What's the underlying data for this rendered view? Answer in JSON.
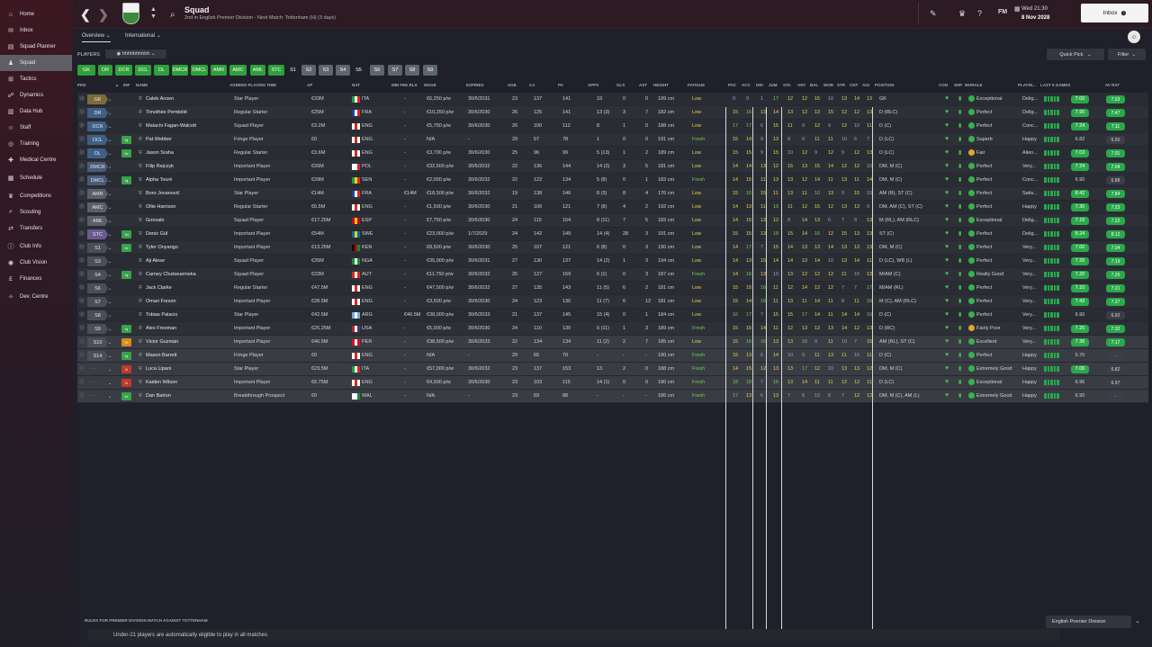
{
  "sidebar": {
    "items": [
      {
        "label": "Home",
        "icon": "home-icon",
        "glyph": "⌂"
      },
      {
        "label": "Inbox",
        "icon": "inbox-icon",
        "glyph": "✉"
      },
      {
        "label": "Squad Planner",
        "icon": "squad-planner-icon",
        "glyph": "▤"
      },
      {
        "label": "Squad",
        "icon": "squad-icon",
        "glyph": "♟",
        "active": true
      },
      {
        "label": "Tactics",
        "icon": "tactics-icon",
        "glyph": "⊞"
      },
      {
        "label": "Dynamics",
        "icon": "dynamics-icon",
        "glyph": "☍"
      },
      {
        "label": "Data Hub",
        "icon": "data-hub-icon",
        "glyph": "▥"
      },
      {
        "label": "Staff",
        "icon": "staff-icon",
        "glyph": "☺"
      },
      {
        "label": "Training",
        "icon": "training-icon",
        "glyph": "◎"
      },
      {
        "label": "Medical Centre",
        "icon": "medical-icon",
        "glyph": "✚"
      },
      {
        "label": "Schedule",
        "icon": "schedule-icon",
        "glyph": "▦"
      },
      {
        "label": "Competitions",
        "icon": "trophy-icon",
        "glyph": "♛"
      },
      {
        "label": "Scouting",
        "icon": "scouting-icon",
        "glyph": "⌕"
      },
      {
        "label": "Transfers",
        "icon": "transfers-icon",
        "glyph": "⇄"
      },
      {
        "label": "Club Info",
        "icon": "club-info-icon",
        "glyph": "ⓘ"
      },
      {
        "label": "Club Vision",
        "icon": "club-vision-icon",
        "glyph": "◉"
      },
      {
        "label": "Finances",
        "icon": "finances-icon",
        "glyph": "£"
      },
      {
        "label": "Dev. Centre",
        "icon": "dev-centre-icon",
        "glyph": "✧"
      }
    ]
  },
  "header": {
    "title": "Squad",
    "subtitle": "2nd in English Premier Division - Next Match: Tottenham (H) (3 days)",
    "date_line1": "Wed 21:30",
    "date_line2": "8 Nov 2028",
    "inbox_label": "Inbox",
    "fm_label": "FM",
    "back": "❮",
    "forward": "❯"
  },
  "subnav": {
    "overview": "Overview",
    "international": "International",
    "players_label": "PLAYERS",
    "view_name": "hhhhhhhhhh",
    "quick_pick": "Quick Pick",
    "filter": "Filter"
  },
  "chips": [
    "GK",
    "DR",
    "DCR",
    "DCL",
    "DL",
    "DMCR",
    "DMCL",
    "AMR",
    "AMC",
    "AML",
    "STC",
    "S1",
    "S2",
    "S3",
    "S4",
    "S5",
    "S6",
    "S7",
    "S8",
    "S9"
  ],
  "columns": {
    "pkd": "PKD",
    "inf": "INF",
    "name": "NAME",
    "apt": "AGREED PLAYING TIME",
    "ap": "AP",
    "nat": "NAT",
    "mfr": "MIN FEE RLS",
    "wage": "WAGE",
    "expires": "EXPIRES",
    "age": "AGE",
    "ca": "CA",
    "pa": "PA",
    "apps": "APPS",
    "gls": "GLS",
    "ast": "AST",
    "height": "HEIGHT",
    "fatigue": "FATIGUE",
    "pac": "PAC",
    "acc": "ACC",
    "dri": "DRI",
    "jum": "JUM",
    "sta": "STA",
    "ant": "ANT",
    "bal": "BAL",
    "wor": "WOR",
    "str": "STR",
    "cnt": "CNT",
    "agi": "AGI",
    "position": "POSITION",
    "con": "CON",
    "shp": "SHP",
    "morale": "MORALE",
    "playing": "PLAYIN...",
    "last5": "LAST 5 GAMES",
    "avrat": "AV RAT"
  },
  "players": [
    {
      "pos": "GK",
      "inf": "",
      "name": "Caleb Ansen",
      "apt": "Star Player",
      "ap": "€33M",
      "nat": "ITA",
      "mfr": "-",
      "wage": "€6,250 p/w",
      "expires": "30/6/2031",
      "age": "23",
      "ca": "137",
      "pa": "141",
      "apps": "19",
      "gls": "0",
      "ast": "0",
      "height": "199 cm",
      "fatigue": "Low",
      "attrs": [
        "9",
        "9",
        "1",
        "17",
        "12",
        "12",
        "15",
        "10",
        "13",
        "14",
        "13"
      ],
      "position": "GK",
      "morale": "Exceptional",
      "playing": "Delig...",
      "last5": "7.00",
      "avrat": "7.03"
    },
    {
      "pos": "DR",
      "inf": "",
      "name": "Timothée Pembélé",
      "apt": "Regular Starter",
      "ap": "€25M",
      "nat": "FRA",
      "mfr": "-",
      "wage": "€10,250 p/w",
      "expires": "30/6/2030",
      "age": "26",
      "ca": "125",
      "pa": "141",
      "apps": "13 (3)",
      "gls": "3",
      "ast": "7",
      "height": "182 cm",
      "fatigue": "Low",
      "attrs": [
        "15",
        "16",
        "13",
        "14",
        "13",
        "12",
        "13",
        "15",
        "12",
        "12",
        "13"
      ],
      "position": "D (RLC)",
      "morale": "Perfect",
      "playing": "Delig...",
      "last5": "7.90",
      "avrat": "7.47"
    },
    {
      "pos": "DCR",
      "inf": "",
      "name": "Malachi Fagan-Walcott",
      "apt": "Squad Player",
      "ap": "€3.2M",
      "nat": "ENG",
      "mfr": "-",
      "wage": "€5,750 p/w",
      "expires": "30/6/2030",
      "age": "26",
      "ca": "100",
      "pa": "112",
      "apps": "8",
      "gls": "1",
      "ast": "0",
      "height": "188 cm",
      "fatigue": "Low",
      "attrs": [
        "17",
        "17",
        "6",
        "15",
        "11",
        "9",
        "12",
        "9",
        "12",
        "10",
        "11"
      ],
      "position": "D (C)",
      "morale": "Perfect",
      "playing": "Conc...",
      "last5": "7.24",
      "avrat": "7.11"
    },
    {
      "pos": "DCL",
      "inf": "Inj",
      "name": "Pat Webber",
      "apt": "Fringe Player",
      "ap": "€0",
      "nat": "ENG",
      "mfr": "-",
      "wage": "N/A",
      "expires": "-",
      "age": "29",
      "ca": "57",
      "pa": "78",
      "apps": "1",
      "gls": "0",
      "ast": "0",
      "height": "191 cm",
      "fatigue": "Fresh",
      "attrs": [
        "15",
        "14",
        "9",
        "13",
        "8",
        "9",
        "11",
        "11",
        "10",
        "6",
        "7"
      ],
      "position": "D (LC)",
      "morale": "Superb",
      "playing": "Happy",
      "last5": "6.82",
      "avrat": "6.50"
    },
    {
      "pos": "DL",
      "inf": "Int",
      "name": "Jason Sraha",
      "apt": "Regular Starter",
      "ap": "€3.6M",
      "nat": "ENG",
      "mfr": "-",
      "wage": "€3,700 p/w",
      "expires": "30/6/2030",
      "age": "25",
      "ca": "96",
      "pa": "99",
      "apps": "5 (13)",
      "gls": "1",
      "ast": "2",
      "height": "189 cm",
      "fatigue": "Low",
      "attrs": [
        "15",
        "15",
        "9",
        "15",
        "10",
        "12",
        "9",
        "12",
        "9",
        "12",
        "13"
      ],
      "position": "D (LC)",
      "morale": "Fair",
      "playing": "Alien...",
      "last5": "7.03",
      "avrat": "7.01"
    },
    {
      "pos": "DMCR",
      "inf": "",
      "name": "Filip Rejczyk",
      "apt": "Important Player",
      "ap": "€26M",
      "nat": "POL",
      "mfr": "-",
      "wage": "€32,500 p/w",
      "expires": "30/6/2032",
      "age": "22",
      "ca": "136",
      "pa": "144",
      "apps": "14 (2)",
      "gls": "3",
      "ast": "5",
      "height": "181 cm",
      "fatigue": "Low",
      "attrs": [
        "14",
        "14",
        "13",
        "12",
        "15",
        "13",
        "15",
        "14",
        "12",
        "12",
        "16"
      ],
      "position": "DM, M (C)",
      "morale": "Perfect",
      "playing": "Very...",
      "last5": "7.24",
      "avrat": "7.04"
    },
    {
      "pos": "DMCL",
      "inf": "Inj",
      "name": "Alpha Touré",
      "apt": "Important Player",
      "ap": "€29M",
      "nat": "SEN",
      "mfr": "-",
      "wage": "€2,000 p/w",
      "expires": "30/6/2032",
      "age": "22",
      "ca": "122",
      "pa": "134",
      "apps": "5 (8)",
      "gls": "0",
      "ast": "1",
      "height": "183 cm",
      "fatigue": "Fresh",
      "attrs": [
        "14",
        "15",
        "11",
        "13",
        "13",
        "12",
        "14",
        "11",
        "13",
        "11",
        "14"
      ],
      "position": "DM, M (C)",
      "morale": "Perfect",
      "playing": "Conc...",
      "last5": "6.90",
      "avrat": "6.88"
    },
    {
      "pos": "AMR",
      "inf": "",
      "name": "Boro Jovanović",
      "apt": "Star Player",
      "ap": "€14M",
      "nat": "FRA",
      "mfr": "€14M",
      "wage": "€18,500 p/w",
      "expires": "30/6/2032",
      "age": "19",
      "ca": "138",
      "pa": "146",
      "apps": "8 (3)",
      "gls": "8",
      "ast": "4",
      "height": "176 cm",
      "fatigue": "Low",
      "attrs": [
        "15",
        "16",
        "15",
        "11",
        "13",
        "11",
        "10",
        "13",
        "9",
        "15",
        "10"
      ],
      "position": "AM (R), ST (C)",
      "morale": "Perfect",
      "playing": "Satis...",
      "last5": "8.42",
      "avrat": "7.84"
    },
    {
      "pos": "AMC",
      "inf": "",
      "name": "Ollie Harrison",
      "apt": "Regular Starter",
      "ap": "€6.5M",
      "nat": "ENG",
      "mfr": "-",
      "wage": "€1,500 p/w",
      "expires": "30/6/2030",
      "age": "21",
      "ca": "106",
      "pa": "121",
      "apps": "7 (8)",
      "gls": "4",
      "ast": "2",
      "height": "192 cm",
      "fatigue": "Low",
      "attrs": [
        "14",
        "13",
        "11",
        "19",
        "11",
        "12",
        "15",
        "12",
        "13",
        "13",
        "9"
      ],
      "position": "DM, AM (C), ST (C)",
      "morale": "Perfect",
      "playing": "Happy",
      "last5": "7.30",
      "avrat": "7.23"
    },
    {
      "pos": "AML",
      "inf": "",
      "name": "Gonzalo",
      "apt": "Squad Player",
      "ap": "€17.25M",
      "nat": "ESP",
      "mfr": "-",
      "wage": "€7,750 p/w",
      "expires": "30/6/2030",
      "age": "24",
      "ca": "115",
      "pa": "154",
      "apps": "8 (11)",
      "gls": "7",
      "ast": "5",
      "height": "183 cm",
      "fatigue": "Low",
      "attrs": [
        "14",
        "15",
        "13",
        "12",
        "8",
        "14",
        "13",
        "6",
        "7",
        "8",
        "13"
      ],
      "position": "M (RL), AM (RLC)",
      "morale": "Exceptional",
      "playing": "Delig...",
      "last5": "7.16",
      "avrat": "7.22"
    },
    {
      "pos": "STC",
      "inf": "Tst",
      "name": "Deniz Gül",
      "apt": "Important Player",
      "ap": "€54M",
      "nat": "SWE",
      "mfr": "-",
      "wage": "€23,000 p/w",
      "expires": "1/7/2029",
      "age": "24",
      "ca": "142",
      "pa": "149",
      "apps": "14 (4)",
      "gls": "28",
      "ast": "3",
      "height": "191 cm",
      "fatigue": "Low",
      "attrs": [
        "15",
        "15",
        "13",
        "18",
        "15",
        "14",
        "16",
        "12",
        "15",
        "13",
        "13"
      ],
      "position": "ST (C)",
      "morale": "Perfect",
      "playing": "Delig...",
      "last5": "8.24",
      "avrat": "8.12"
    },
    {
      "pos": "S1",
      "inf": "Int",
      "name": "Tyler Onyango",
      "apt": "Important Player",
      "ap": "€13.25M",
      "nat": "KEN",
      "mfr": "-",
      "wage": "€8,500 p/w",
      "expires": "30/6/2030",
      "age": "25",
      "ca": "107",
      "pa": "121",
      "apps": "6 (8)",
      "gls": "0",
      "ast": "3",
      "height": "190 cm",
      "fatigue": "Low",
      "attrs": [
        "14",
        "17",
        "7",
        "15",
        "14",
        "13",
        "13",
        "14",
        "13",
        "13",
        "13"
      ],
      "position": "DM, M (C)",
      "morale": "Perfect",
      "playing": "Very...",
      "last5": "7.00",
      "avrat": "7.04"
    },
    {
      "pos": "S3",
      "inf": "",
      "name": "Aji Alese",
      "apt": "Squad Player",
      "ap": "€35M",
      "nat": "NGA",
      "mfr": "-",
      "wage": "€35,000 p/w",
      "expires": "30/6/2031",
      "age": "27",
      "ca": "130",
      "pa": "137",
      "apps": "14 (2)",
      "gls": "1",
      "ast": "3",
      "height": "194 cm",
      "fatigue": "Low",
      "attrs": [
        "14",
        "13",
        "15",
        "14",
        "14",
        "13",
        "14",
        "10",
        "13",
        "14",
        "11"
      ],
      "position": "D (LC), WB (L)",
      "morale": "Perfect",
      "playing": "Very...",
      "last5": "7.26",
      "avrat": "7.19"
    },
    {
      "pos": "S4",
      "inf": "Inj",
      "name": "Carney Chukwuemeka",
      "apt": "Squad Player",
      "ap": "€22M",
      "nat": "AUT",
      "mfr": "-",
      "wage": "€11,750 p/w",
      "expires": "30/6/2032",
      "age": "25",
      "ca": "127",
      "pa": "159",
      "apps": "6 (1)",
      "gls": "0",
      "ast": "3",
      "height": "187 cm",
      "fatigue": "Fresh",
      "attrs": [
        "14",
        "16",
        "13",
        "10",
        "13",
        "12",
        "12",
        "12",
        "11",
        "10",
        "13"
      ],
      "position": "M/AM (C)",
      "morale": "Really Good",
      "playing": "Very...",
      "last5": "7.20",
      "avrat": "7.25"
    },
    {
      "pos": "S6",
      "inf": "",
      "name": "Jack Clarke",
      "apt": "Regular Starter",
      "ap": "€47.5M",
      "nat": "ENG",
      "mfr": "-",
      "wage": "€47,500 p/w",
      "expires": "30/6/2032",
      "age": "27",
      "ca": "135",
      "pa": "143",
      "apps": "11 (5)",
      "gls": "6",
      "ast": "2",
      "height": "181 cm",
      "fatigue": "Low",
      "attrs": [
        "15",
        "15",
        "16",
        "11",
        "12",
        "14",
        "12",
        "12",
        "7",
        "7",
        "17"
      ],
      "position": "M/AM (RL)",
      "morale": "Perfect",
      "playing": "Very...",
      "last5": "7.10",
      "avrat": "7.21"
    },
    {
      "pos": "S7",
      "inf": "",
      "name": "Omari Forson",
      "apt": "Important Player",
      "ap": "€28.5M",
      "nat": "ENG",
      "mfr": "-",
      "wage": "€3,500 p/w",
      "expires": "30/6/2030",
      "age": "24",
      "ca": "123",
      "pa": "130",
      "apps": "11 (7)",
      "gls": "6",
      "ast": "12",
      "height": "181 cm",
      "fatigue": "Low",
      "attrs": [
        "15",
        "14",
        "16",
        "11",
        "13",
        "11",
        "14",
        "11",
        "8",
        "11",
        "16"
      ],
      "position": "M (C), AM (RLC)",
      "morale": "Perfect",
      "playing": "Very...",
      "last5": "7.43",
      "avrat": "7.27"
    },
    {
      "pos": "S8",
      "inf": "",
      "name": "Tobias Palacio",
      "apt": "Star Player",
      "ap": "€42.5M",
      "nat": "ARG",
      "mfr": "€46.5M",
      "wage": "€38,000 p/w",
      "expires": "30/6/2033",
      "age": "21",
      "ca": "137",
      "pa": "145",
      "apps": "15 (4)",
      "gls": "0",
      "ast": "1",
      "height": "184 cm",
      "fatigue": "Low",
      "attrs": [
        "16",
        "17",
        "7",
        "15",
        "15",
        "17",
        "14",
        "11",
        "14",
        "14",
        "16"
      ],
      "position": "D (C)",
      "morale": "Perfect",
      "playing": "Very...",
      "last5": "6.90",
      "avrat": "6.92"
    },
    {
      "pos": "S9",
      "inf": "Inj",
      "name": "Alex Freeman",
      "apt": "Important Player",
      "ap": "€25.25M",
      "nat": "USA",
      "mfr": "-",
      "wage": "€5,000 p/w",
      "expires": "30/6/2030",
      "age": "24",
      "ca": "110",
      "pa": "130",
      "apps": "6 (11)",
      "gls": "1",
      "ast": "3",
      "height": "189 cm",
      "fatigue": "Fresh",
      "attrs": [
        "15",
        "15",
        "14",
        "11",
        "12",
        "13",
        "12",
        "13",
        "14",
        "12",
        "13"
      ],
      "position": "D (RC)",
      "morale": "Fairly Poor",
      "playing": "Very...",
      "last5": "7.20",
      "avrat": "7.32"
    },
    {
      "pos": "S10",
      "inf": "Fit",
      "name": "Victor Guzmán",
      "apt": "Important Player",
      "ap": "€46.5M",
      "nat": "PER",
      "mfr": "-",
      "wage": "€38,500 p/w",
      "expires": "30/6/2033",
      "age": "22",
      "ca": "134",
      "pa": "134",
      "apps": "11 (2)",
      "gls": "2",
      "ast": "7",
      "height": "185 cm",
      "fatigue": "Low",
      "attrs": [
        "15",
        "16",
        "16",
        "13",
        "13",
        "16",
        "9",
        "11",
        "10",
        "7",
        "15"
      ],
      "position": "AM (RL), ST (C)",
      "morale": "Excellent",
      "playing": "Very...",
      "last5": "7.36",
      "avrat": "7.17"
    },
    {
      "pos": "S14",
      "inf": "Inj",
      "name": "Mason Barrett",
      "apt": "Fringe Player",
      "ap": "€0",
      "nat": "ENG",
      "mfr": "-",
      "wage": "N/A",
      "expires": "-",
      "age": "29",
      "ca": "65",
      "pa": "70",
      "apps": "-",
      "gls": "-",
      "ast": "-",
      "height": "190 cm",
      "fatigue": "Fresh",
      "attrs": [
        "15",
        "13",
        "6",
        "14",
        "10",
        "9",
        "11",
        "13",
        "11",
        "10",
        "11"
      ],
      "position": "D (C)",
      "morale": "Perfect",
      "playing": "Happy",
      "last5": "6.70",
      "avrat": "-"
    },
    {
      "pos": "",
      "inf": "Ill",
      "name": "Luca Lipani",
      "apt": "Star Player",
      "ap": "€23.5M",
      "nat": "ITA",
      "mfr": "-",
      "wage": "€57,000 p/w",
      "expires": "30/6/2032",
      "age": "23",
      "ca": "137",
      "pa": "153",
      "apps": "13",
      "gls": "2",
      "ast": "0",
      "height": "188 cm",
      "fatigue": "Fresh",
      "attrs": [
        "14",
        "15",
        "12",
        "13",
        "13",
        "17",
        "12",
        "10",
        "13",
        "13",
        "12"
      ],
      "position": "DM, M (C)",
      "morale": "Extremely Good",
      "playing": "Happy",
      "last5": "7.06",
      "avrat": "6.82"
    },
    {
      "pos": "",
      "inf": "Ill",
      "name": "Kaiden Wilson",
      "apt": "Important Player",
      "ap": "€6.75M",
      "nat": "ENG",
      "mfr": "-",
      "wage": "€4,500 p/w",
      "expires": "30/6/2030",
      "age": "23",
      "ca": "103",
      "pa": "115",
      "apps": "14 (1)",
      "gls": "0",
      "ast": "0",
      "height": "190 cm",
      "fatigue": "Fresh",
      "attrs": [
        "18",
        "18",
        "7",
        "16",
        "13",
        "14",
        "11",
        "11",
        "12",
        "12",
        "11"
      ],
      "position": "D (LC)",
      "morale": "Exceptional",
      "playing": "Happy",
      "last5": "6.96",
      "avrat": "6.97"
    },
    {
      "pos": "",
      "inf": "Int",
      "name": "Dan Barton",
      "apt": "Breakthrough Prospect",
      "ap": "€0",
      "nat": "WAL",
      "mfr": "-",
      "wage": "N/A",
      "expires": "-",
      "age": "23",
      "ca": "69",
      "pa": "88",
      "apps": "-",
      "gls": "-",
      "ast": "-",
      "height": "186 cm",
      "fatigue": "Fresh",
      "attrs": [
        "17",
        "13",
        "6",
        "13",
        "7",
        "8",
        "10",
        "8",
        "7",
        "12",
        "12"
      ],
      "position": "DM, M (C), AM (L)",
      "morale": "Extremely Good",
      "playing": "Happy",
      "last5": "6.90",
      "avrat": "-"
    }
  ],
  "footer": {
    "rules_title": "RULES FOR PREMIER DIVISION MATCH AGAINST TOTTENHAM",
    "rule_text": "Under-21 players are automatically eligible to play in all matches",
    "competition": "English Premier Division"
  },
  "colors": {
    "accent": "#2fa03b",
    "sidebar": "#3c1822",
    "topbar": "#2d1b24"
  }
}
